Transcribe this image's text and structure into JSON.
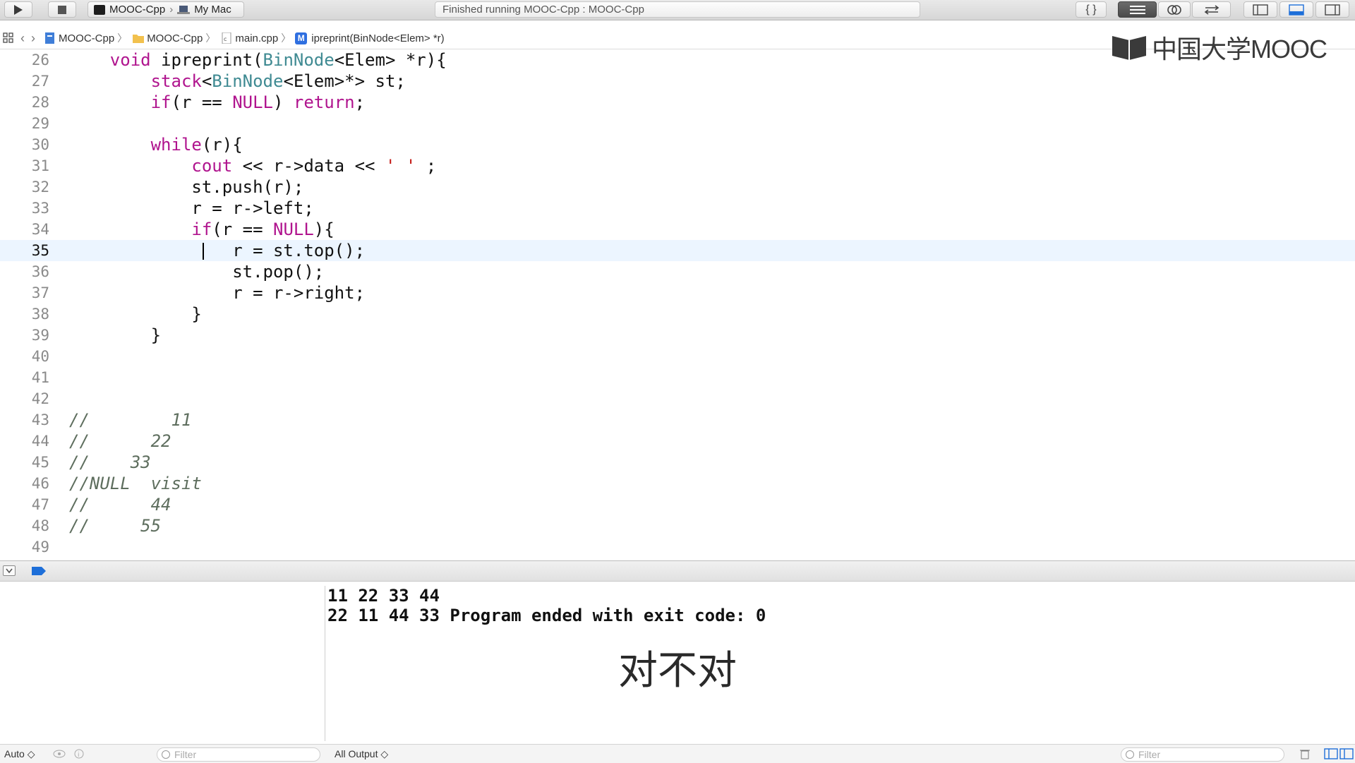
{
  "toolbar": {
    "scheme_target": "MOOC-Cpp",
    "scheme_device": "My Mac",
    "activity_status": "Finished running MOOC-Cpp : MOOC-Cpp"
  },
  "jumpbar": {
    "items": [
      "MOOC-Cpp",
      "MOOC-Cpp",
      "main.cpp",
      "ipreprint(BinNode<Elem> *r)"
    ],
    "method_badge": "M"
  },
  "logo": {
    "text": "中国大学MOOC"
  },
  "editor": {
    "current_line": 35,
    "lines": [
      {
        "n": "26",
        "code": "    void ipreprint(BinNode<Elem> *r){"
      },
      {
        "n": "27",
        "code": "        stack<BinNode<Elem>*> st;"
      },
      {
        "n": "28",
        "code": "        if(r == NULL) return;"
      },
      {
        "n": "29",
        "code": ""
      },
      {
        "n": "30",
        "code": "        while(r){"
      },
      {
        "n": "31",
        "code": "            cout << r->data << ' ' ;"
      },
      {
        "n": "32",
        "code": "            st.push(r);"
      },
      {
        "n": "33",
        "code": "            r = r->left;"
      },
      {
        "n": "34",
        "code": "            if(r == NULL){"
      },
      {
        "n": "35",
        "code": "                r = st.top();"
      },
      {
        "n": "36",
        "code": "                st.pop();"
      },
      {
        "n": "37",
        "code": "                r = r->right;"
      },
      {
        "n": "38",
        "code": "            }"
      },
      {
        "n": "39",
        "code": "        }"
      },
      {
        "n": "40",
        "code": ""
      },
      {
        "n": "41",
        "code": ""
      },
      {
        "n": "42",
        "code": ""
      },
      {
        "n": "43",
        "code": "//        11"
      },
      {
        "n": "44",
        "code": "//      22"
      },
      {
        "n": "45",
        "code": "//    33"
      },
      {
        "n": "46",
        "code": "//NULL  visit"
      },
      {
        "n": "47",
        "code": "//      44"
      },
      {
        "n": "48",
        "code": "//     55"
      },
      {
        "n": "49",
        "code": ""
      }
    ]
  },
  "console": {
    "lines": [
      "11 22 33 44",
      "22 11 44 33 Program ended with exit code: 0"
    ]
  },
  "subtitle": "对不对",
  "bottom": {
    "auto_label": "Auto ◇",
    "filter_left_placeholder": "Filter",
    "output_select": "All Output ◇",
    "filter_right_placeholder": "Filter"
  },
  "colors": {
    "keyword": "#b0148e",
    "type": "#3f8a92",
    "string": "#c41a16",
    "comment": "#5e6e5e",
    "current_line_bg": "#ecf5ff"
  }
}
